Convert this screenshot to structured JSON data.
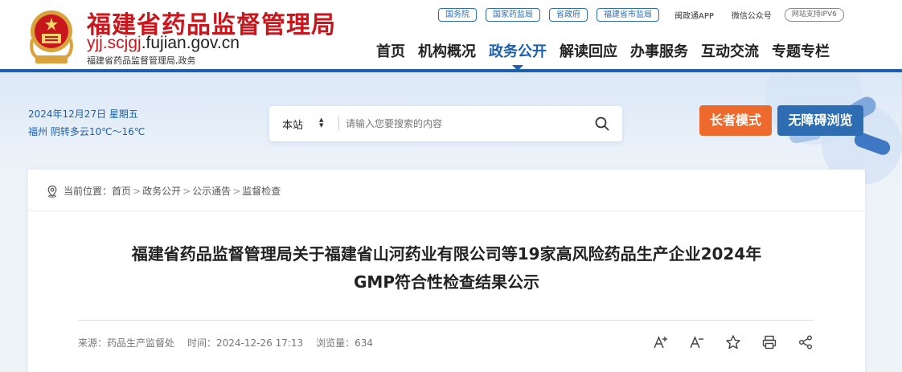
{
  "site": {
    "name_cn": "福建省药品监督管理局",
    "url_prefix": "yjj.scjgj",
    "url_suffix": ".fujian.gov.cn",
    "subtitle": "福建省药品监督管理局,政务"
  },
  "toplinks": [
    "国务院",
    "国家药监局",
    "省政府",
    "福建省市监局"
  ],
  "toptexts": [
    "闽政通APP",
    "微信公众号"
  ],
  "ipv6": "网站支持IPV6",
  "nav": {
    "items": [
      "首页",
      "机构概况",
      "政务公开",
      "解读回应",
      "办事服务",
      "互动交流",
      "专题专栏"
    ],
    "active_index": 2
  },
  "info": {
    "date": "2024年12月27日  星期五",
    "weather": "福州  阴转多云10℃～16℃"
  },
  "search": {
    "scope": "本站",
    "placeholder": "请输入您要搜索的内容"
  },
  "buttons": {
    "elder_mode": "长者模式",
    "accessible": "无障碍浏览"
  },
  "breadcrumb": {
    "label": "当前位置：",
    "items": [
      "首页",
      "政务公开",
      "公示通告",
      "监督检查"
    ]
  },
  "article": {
    "title_line1": "福建省药品监督管理局关于福建省山河药业有限公司等19家高风险药品生产企业2024年",
    "title_line2": "GMP符合性检查结果公示",
    "source": "来源：药品生产监督处",
    "time": "时间：2024-12-26 17:13",
    "views": "浏览量：634"
  },
  "tools": [
    "font-increase-icon",
    "font-decrease-icon",
    "star-icon",
    "print-icon",
    "share-icon"
  ],
  "colors": {
    "brand_red": "#c8161d",
    "brand_blue": "#1d5fab",
    "elder_orange": "#ee6a2c",
    "access_blue": "#2e6db2"
  }
}
